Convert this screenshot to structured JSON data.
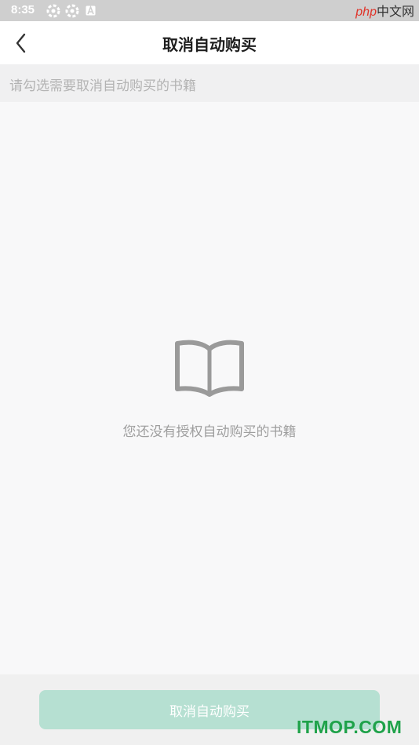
{
  "status_bar": {
    "time": "8:35",
    "icons": [
      "settings-gear-icon",
      "settings-gear-icon",
      "app-a-icon"
    ]
  },
  "watermark_top": {
    "php": "php",
    "cn": "中文网"
  },
  "header": {
    "title": "取消自动购买",
    "back_icon": "chevron-left-icon"
  },
  "hint": {
    "text": "请勾选需要取消自动购买的书籍"
  },
  "empty_state": {
    "icon": "open-book-icon",
    "message": "您还没有授权自动购买的书籍"
  },
  "footer": {
    "button_label": "取消自动购买"
  },
  "watermark_bottom": {
    "text": "ITMOP.COM"
  },
  "colors": {
    "accent_disabled": "#b6e0d2",
    "watermark_green": "#1fa24a",
    "watermark_red": "#e0342a",
    "icon_gray": "#9a9a9a"
  }
}
